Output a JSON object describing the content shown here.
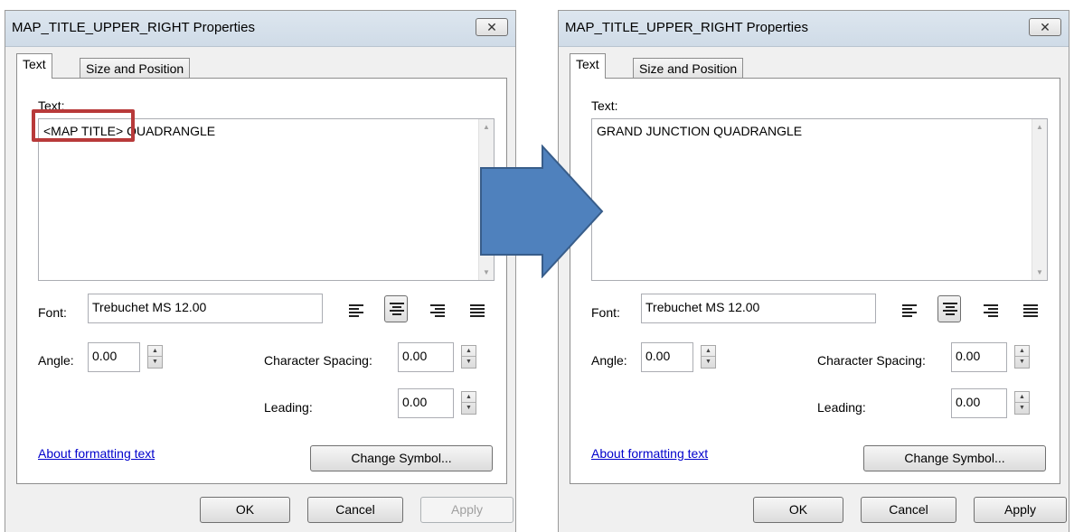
{
  "left_dialog": {
    "title": "MAP_TITLE_UPPER_RIGHT Properties",
    "close_glyph": "✕",
    "tab_text": "Text",
    "tab_size_position": "Size and Position",
    "text_label": "Text:",
    "text_content_highlight": "<MAP TITLE>",
    "text_content_rest": " QUADRANGLE",
    "font_label": "Font:",
    "font_value": "Trebuchet MS 12.00",
    "angle_label": "Angle:",
    "angle_value": "0.00",
    "char_spacing_label": "Character Spacing:",
    "char_spacing_value": "0.00",
    "leading_label": "Leading:",
    "leading_value": "0.00",
    "about_link": "About formatting text",
    "change_symbol": "Change Symbol...",
    "ok": "OK",
    "cancel": "Cancel",
    "apply": "Apply",
    "apply_enabled": false
  },
  "right_dialog": {
    "title": "MAP_TITLE_UPPER_RIGHT Properties",
    "close_glyph": "✕",
    "tab_text": "Text",
    "tab_size_position": "Size and Position",
    "text_label": "Text:",
    "text_content": "GRAND JUNCTION QUADRANGLE",
    "font_label": "Font:",
    "font_value": "Trebuchet MS 12.00",
    "angle_label": "Angle:",
    "angle_value": "0.00",
    "char_spacing_label": "Character Spacing:",
    "char_spacing_value": "0.00",
    "leading_label": "Leading:",
    "leading_value": "0.00",
    "about_link": "About formatting text",
    "change_symbol": "Change Symbol...",
    "ok": "OK",
    "cancel": "Cancel",
    "apply": "Apply",
    "apply_enabled": true
  },
  "colors": {
    "arrow_fill": "#4f81bd",
    "arrow_stroke": "#385d8a",
    "highlight_border": "#b83a3a",
    "link": "#0000cc"
  }
}
